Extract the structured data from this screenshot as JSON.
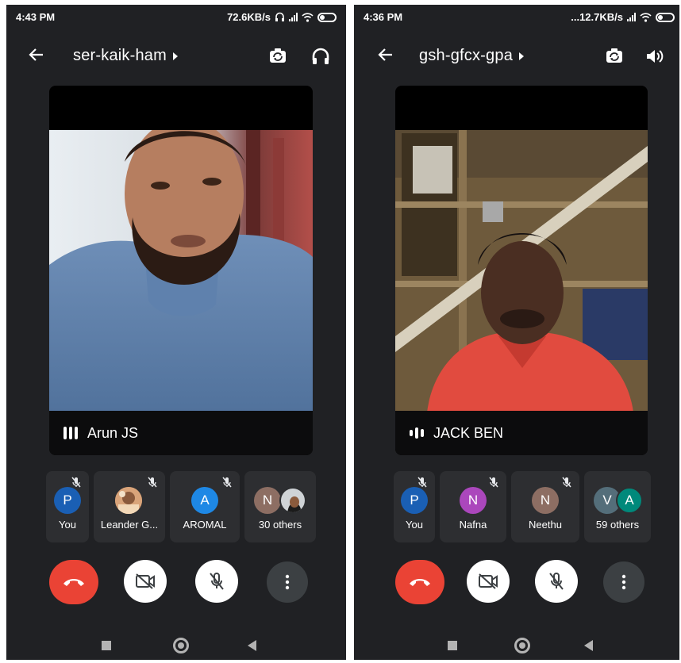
{
  "left": {
    "status": {
      "time": "4:43 PM",
      "speed": "72.6KB/s"
    },
    "meeting_code": "ser-kaik-ham",
    "speaker": {
      "name": "Arun JS"
    },
    "participants": [
      {
        "initial": "P",
        "label": "You",
        "color": "#1a5fb4"
      },
      {
        "initial": "",
        "label": "Leander G...",
        "color": "#c98a5a"
      },
      {
        "initial": "A",
        "label": "AROMAL",
        "color": "#1e88e5"
      },
      {
        "initial": "N",
        "label": "30 others",
        "color": "#8d6e63"
      }
    ],
    "icons": {
      "header_right": "headphones-icon"
    }
  },
  "right": {
    "status": {
      "time": "4:36 PM",
      "speed": "...12.7KB/s"
    },
    "meeting_code": "gsh-gfcx-gpa",
    "speaker": {
      "name": "JACK BEN"
    },
    "participants": [
      {
        "initial": "P",
        "label": "You",
        "color": "#1a5fb4"
      },
      {
        "initial": "N",
        "label": "Nafna",
        "color": "#ab47bc"
      },
      {
        "initial": "N",
        "label": "Neethu",
        "color": "#8d6e63"
      },
      {
        "initial": "V",
        "initial2": "A",
        "label": "59 others",
        "color": "#546e7a",
        "color2": "#00897b"
      }
    ],
    "icons": {
      "header_right": "speaker-icon"
    }
  },
  "colors": {
    "background": "#202124",
    "end_call": "#ea4335",
    "tile": "#2d2e31"
  }
}
